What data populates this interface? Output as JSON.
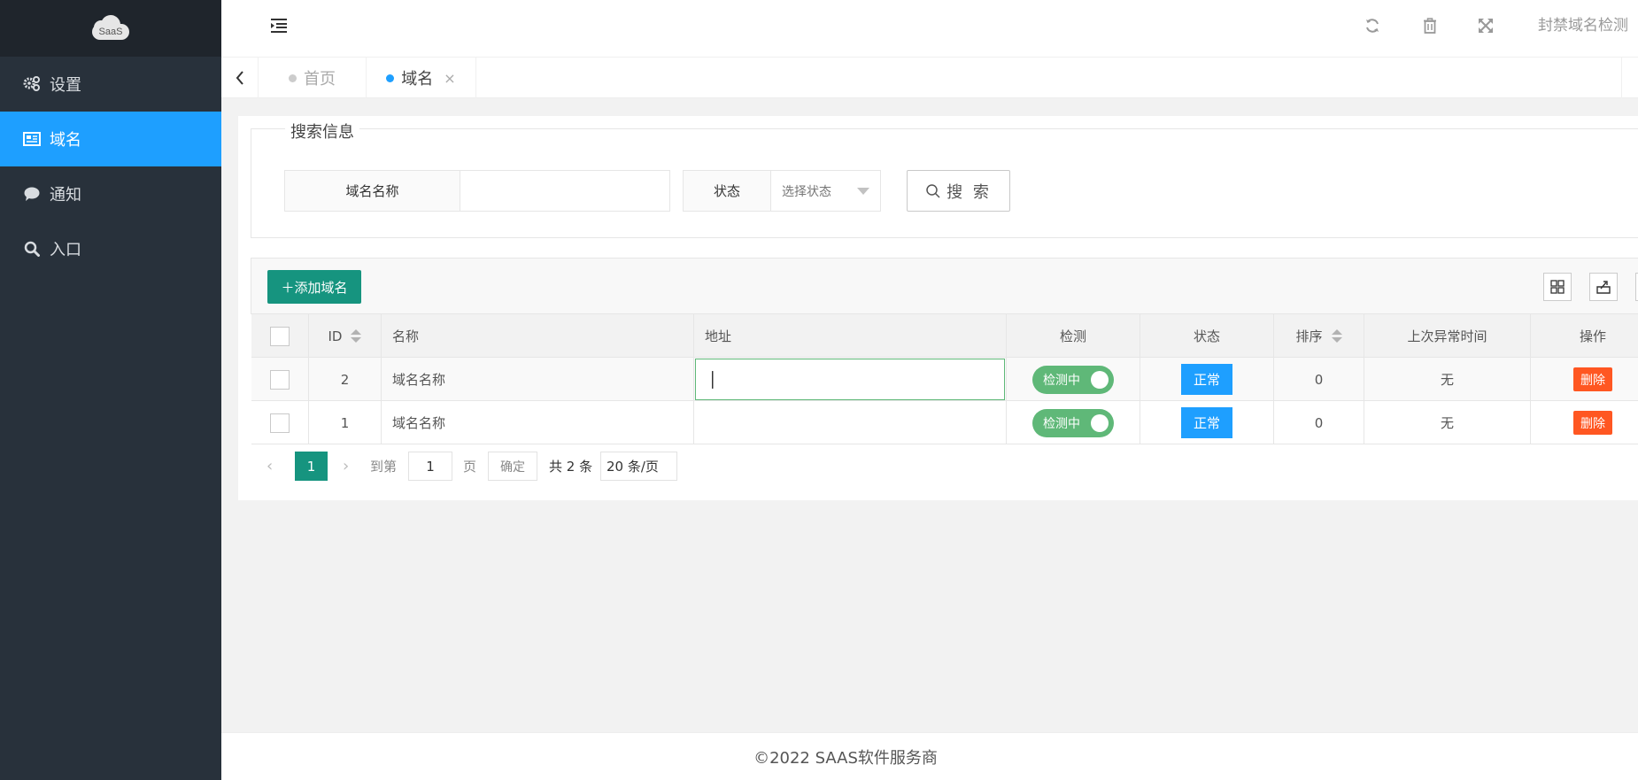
{
  "sidebar": {
    "logo_text": "SaaS",
    "items": [
      {
        "label": "设置",
        "icon": "gears-icon"
      },
      {
        "label": "域名",
        "icon": "newspaper-icon",
        "active": true
      },
      {
        "label": "通知",
        "icon": "comment-icon"
      },
      {
        "label": "入口",
        "icon": "search-icon"
      }
    ]
  },
  "header": {
    "title": "封禁域名检测",
    "icons": [
      "refresh-icon",
      "trash-icon",
      "fullscreen-icon"
    ]
  },
  "tabs": [
    {
      "label": "首页"
    },
    {
      "label": "域名",
      "active": true,
      "close": "×"
    }
  ],
  "search": {
    "legend": "搜索信息",
    "domain_label": "域名名称",
    "domain_value": "",
    "status_label": "状态",
    "status_placeholder": "选择状态",
    "button_label": "搜 索"
  },
  "toolbar": {
    "add_label": "＋添加域名",
    "icons": [
      "columns-icon",
      "export-icon",
      "print-icon"
    ]
  },
  "table": {
    "headers": {
      "id": "ID",
      "name": "名称",
      "address": "地址",
      "check": "检测",
      "status": "状态",
      "order": "排序",
      "last_error": "上次异常时间",
      "actions": "操作"
    },
    "rows": [
      {
        "id": "2",
        "name": "域名名称",
        "address": "",
        "check": "检测中",
        "status": "正常",
        "order": "0",
        "last_error": "无",
        "action": "删除",
        "editing": true
      },
      {
        "id": "1",
        "name": "域名名称",
        "address": "",
        "check": "检测中",
        "status": "正常",
        "order": "0",
        "last_error": "无",
        "action": "删除"
      }
    ]
  },
  "pagination": {
    "prev": "‹",
    "current": "1",
    "next": "›",
    "goto_label": "到第",
    "goto_value": "1",
    "page_label": "页",
    "confirm": "确定",
    "total": "共 2 条",
    "per_page": "20 条/页"
  },
  "footer": {
    "text": "©2022 SAAS软件服务商"
  },
  "colors": {
    "sidebar": "#28313b",
    "active": "#1e9fff",
    "primary": "#16947f",
    "switch": "#5fb878",
    "danger": "#ff5722"
  }
}
